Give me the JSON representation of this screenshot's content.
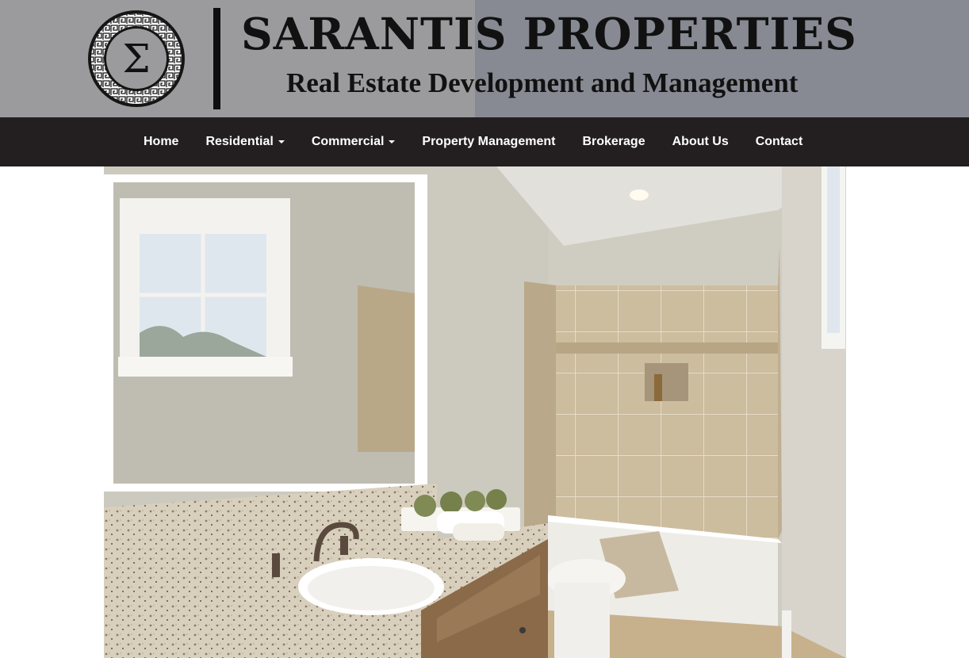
{
  "brand": {
    "name": "SARANTIS PROPERTIES",
    "tagline": "Real Estate Development and Management",
    "logo_glyph": "Σ",
    "logo_icon": "greek-key-sigma-emblem"
  },
  "nav": {
    "items": [
      {
        "label": "Home",
        "dropdown": false
      },
      {
        "label": "Residential",
        "dropdown": true
      },
      {
        "label": "Commercial",
        "dropdown": true
      },
      {
        "label": "Property Management",
        "dropdown": false
      },
      {
        "label": "Brokerage",
        "dropdown": false
      },
      {
        "label": "About Us",
        "dropdown": false
      },
      {
        "label": "Contact",
        "dropdown": false
      }
    ]
  },
  "hero": {
    "image": "bathroom-interior-photo"
  },
  "colors": {
    "header_left": "#9b9b9d",
    "header_right": "#878a93",
    "navbar": "#231f20",
    "nav_text": "#ffffff"
  }
}
